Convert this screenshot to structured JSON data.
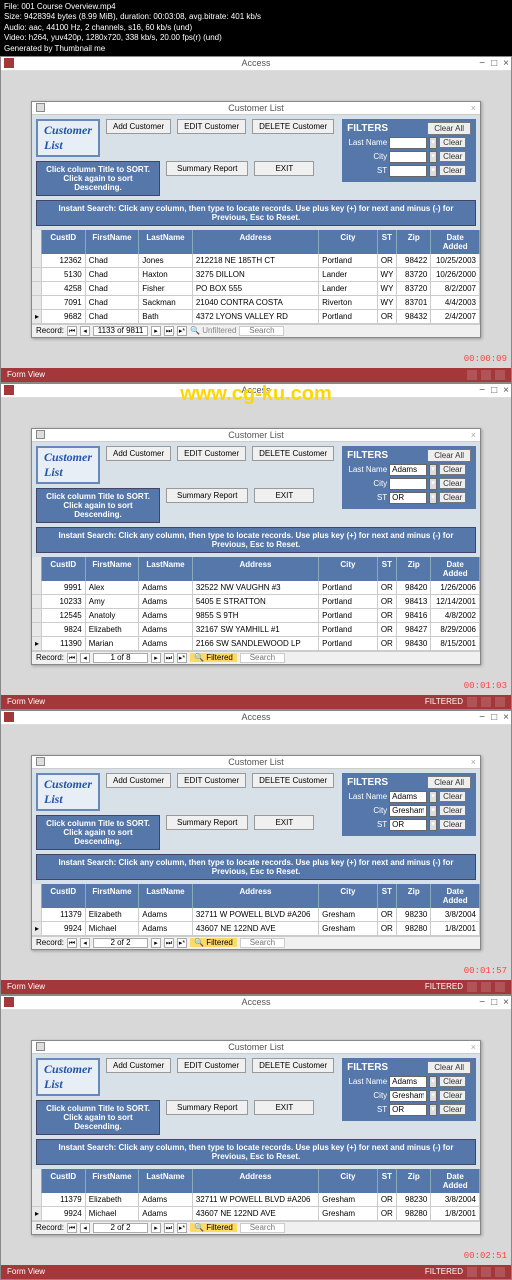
{
  "metadata": {
    "l1": "File: 001 Course Overview.mp4",
    "l2": "Size: 9428394 bytes (8.99 MiB), duration: 00:03:08, avg.bitrate: 401 kb/s",
    "l3": "Audio: aac, 44100 Hz, 2 channels, s16, 60 kb/s (und)",
    "l4": "Video: h264, yuv420p, 1280x720, 338 kb/s, 20.00 fps(r) (und)",
    "l5": "Generated by Thumbnail me"
  },
  "common": {
    "access_title": "Access",
    "form_title": "Customer List",
    "header": "Customer List",
    "add_btn": "Add Customer",
    "edit_btn": "EDIT Customer",
    "del_btn": "DELETE Customer",
    "summary_btn": "Summary Report",
    "exit_btn": "EXIT",
    "sort_hint": "Click column Title to SORT. Click again to sort Descending.",
    "search_hint": "Instant Search: Click any column, then type to locate records. Use plus key (+) for next and minus (-) for Previous, Esc to Reset.",
    "filters_label": "FILTERS",
    "clearall": "Clear All",
    "lastname_lbl": "Last Name",
    "city_lbl": "City",
    "st_lbl": "ST",
    "clear_btn": "Clear",
    "col_id": "CustID",
    "col_fn": "FirstName",
    "col_ln": "LastName",
    "col_addr": "Address",
    "col_city": "City",
    "col_st": "ST",
    "col_zip": "Zip",
    "col_date": "Date Added",
    "record_lbl": "Record:",
    "search_ph": "Search",
    "form_view": "Form View",
    "filtered": "FILTERED",
    "watermark": "www.cg-ku.com"
  },
  "panel1": {
    "filters": {
      "lastname": "",
      "city": "",
      "st": ""
    },
    "rows": [
      {
        "id": "12362",
        "fn": "Chad",
        "ln": "Jones",
        "addr": "212218 NE 185TH CT",
        "city": "Portland",
        "st": "OR",
        "zip": "98422",
        "date": "10/25/2003"
      },
      {
        "id": "5130",
        "fn": "Chad",
        "ln": "Haxton",
        "addr": "3275 DILLON",
        "city": "Lander",
        "st": "WY",
        "zip": "83720",
        "date": "10/26/2000"
      },
      {
        "id": "4258",
        "fn": "Chad",
        "ln": "Fisher",
        "addr": "PO BOX 555",
        "city": "Lander",
        "st": "WY",
        "zip": "83720",
        "date": "8/2/2007"
      },
      {
        "id": "7091",
        "fn": "Chad",
        "ln": "Sackman",
        "addr": "21040 CONTRA COSTA",
        "city": "Riverton",
        "st": "WY",
        "zip": "83701",
        "date": "4/4/2003"
      },
      {
        "id": "9682",
        "fn": "Chad",
        "ln": "Bath",
        "addr": "4372 LYONS VALLEY RD",
        "city": "Portland",
        "st": "OR",
        "zip": "98432",
        "date": "2/4/2007"
      }
    ],
    "nav": {
      "pos": "1133 of 9811",
      "filter": "Unfiltered"
    },
    "ts": "00:00:09"
  },
  "panel2": {
    "filters": {
      "lastname": "Adams",
      "city": "",
      "st": "OR"
    },
    "rows": [
      {
        "id": "9991",
        "fn": "Alex",
        "ln": "Adams",
        "addr": "32522 NW VAUGHN #3",
        "city": "Portland",
        "st": "OR",
        "zip": "98420",
        "date": "1/26/2006"
      },
      {
        "id": "10233",
        "fn": "Amy",
        "ln": "Adams",
        "addr": "5405 E STRATTON",
        "city": "Portland",
        "st": "OR",
        "zip": "98413",
        "date": "12/14/2001"
      },
      {
        "id": "12545",
        "fn": "Anatoly",
        "ln": "Adams",
        "addr": "9855 S 9TH",
        "city": "Portland",
        "st": "OR",
        "zip": "98416",
        "date": "4/8/2002"
      },
      {
        "id": "9824",
        "fn": "Elizabeth",
        "ln": "Adams",
        "addr": "32167 SW YAMHILL #1",
        "city": "Portland",
        "st": "OR",
        "zip": "98427",
        "date": "8/29/2006"
      },
      {
        "id": "11390",
        "fn": "Marian",
        "ln": "Adams",
        "addr": "2166 SW SANDLEWOOD LP",
        "city": "Portland",
        "st": "OR",
        "zip": "98430",
        "date": "8/15/2001"
      }
    ],
    "nav": {
      "pos": "1 of 8",
      "filter": "Filtered"
    },
    "ts": "00:01:03",
    "status_filtered": "FILTERED"
  },
  "panel3": {
    "filters": {
      "lastname": "Adams",
      "city": "Gresham",
      "st": "OR"
    },
    "rows": [
      {
        "id": "11379",
        "fn": "Elizabeth",
        "ln": "Adams",
        "addr": "32711 W POWELL BLVD #A206",
        "city": "Gresham",
        "st": "OR",
        "zip": "98230",
        "date": "3/8/2004"
      },
      {
        "id": "9924",
        "fn": "Michael",
        "ln": "Adams",
        "addr": "43607 NE 122ND AVE",
        "city": "Gresham",
        "st": "OR",
        "zip": "98280",
        "date": "1/8/2001"
      }
    ],
    "nav": {
      "pos": "2 of 2",
      "filter": "Filtered"
    },
    "ts": "00:01:57",
    "status_filtered": "FILTERED"
  },
  "panel4": {
    "filters": {
      "lastname": "Adams",
      "city": "Gresham",
      "st": "OR"
    },
    "rows": [
      {
        "id": "11379",
        "fn": "Elizabeth",
        "ln": "Adams",
        "addr": "32711 W POWELL BLVD #A206",
        "city": "Gresham",
        "st": "OR",
        "zip": "98230",
        "date": "3/8/2004"
      },
      {
        "id": "9924",
        "fn": "Michael",
        "ln": "Adams",
        "addr": "43607 NE 122ND AVE",
        "city": "Gresham",
        "st": "OR",
        "zip": "98280",
        "date": "1/8/2001"
      }
    ],
    "nav": {
      "pos": "2 of 2",
      "filter": "Filtered"
    },
    "ts": "00:02:51",
    "status_filtered": "FILTERED"
  }
}
